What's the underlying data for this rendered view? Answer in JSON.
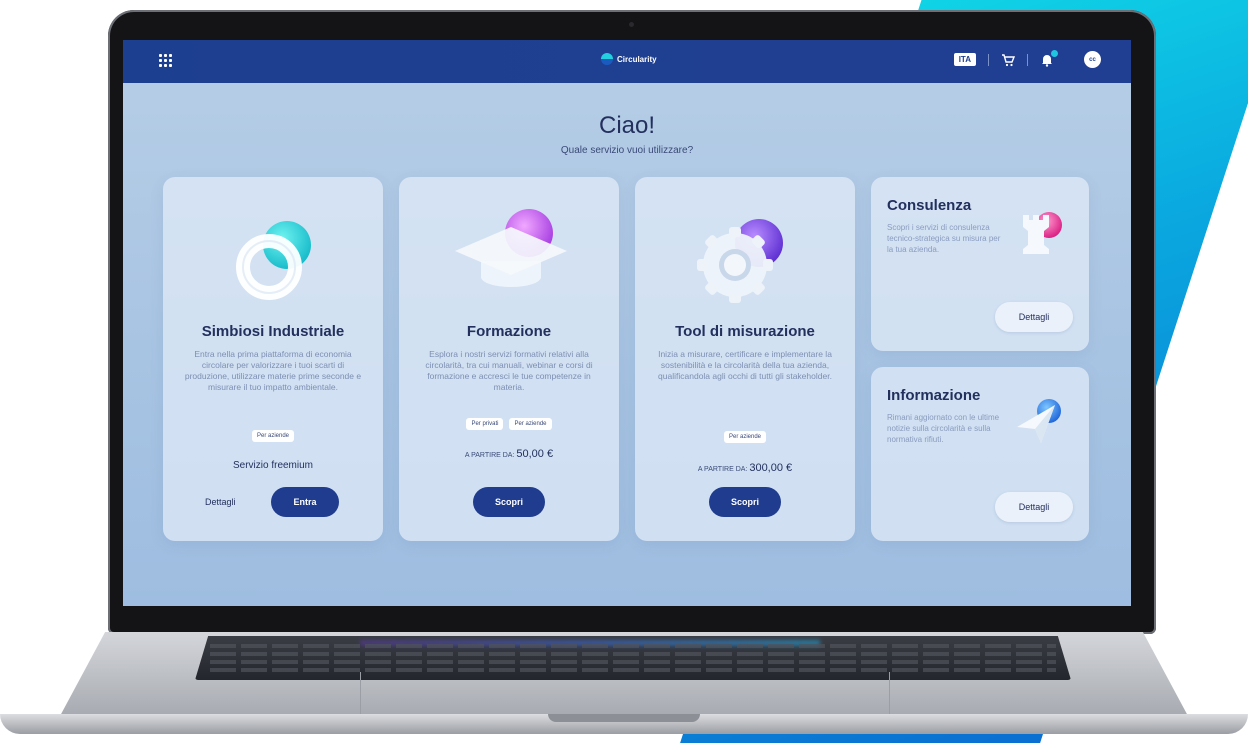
{
  "topbar": {
    "brand": "Circularity",
    "lang": "ITA",
    "avatar_initials": "cc"
  },
  "hero": {
    "title": "Ciao!",
    "subtitle": "Quale servizio vuoi utilizzare?"
  },
  "cards": [
    {
      "title": "Simbiosi Industriale",
      "description": "Entra nella prima piattaforma di economia circolare per valorizzare i tuoi scarti di produzione, utilizzare materie prime seconde e misurare il tuo impatto ambientale.",
      "chips": [
        "Per aziende"
      ],
      "note": "Servizio freemium",
      "link": "Dettagli",
      "button": "Entra"
    },
    {
      "title": "Formazione",
      "description": "Esplora i nostri servizi formativi relativi alla circolarità, tra cui manuali, webinar e corsi di formazione e accresci le tue competenze in materia.",
      "chips": [
        "Per privati",
        "Per aziende"
      ],
      "price_prefix": "A PARTIRE DA:",
      "price": "50,00 €",
      "button": "Scopri"
    },
    {
      "title": "Tool di misurazione",
      "description": "Inizia a misurare, certificare e implementare la sostenibilità e la circolarità della tua azienda, qualificandola agli occhi di tutti gli stakeholder.",
      "chips": [
        "Per aziende"
      ],
      "price_prefix": "A PARTIRE DA:",
      "price": "300,00 €",
      "button": "Scopri"
    }
  ],
  "side_cards": [
    {
      "title": "Consulenza",
      "description": "Scopri i servizi di consulenza tecnico-strategica su misura per la tua azienda.",
      "button": "Dettagli"
    },
    {
      "title": "Informazione",
      "description": "Rimani aggiornato con le ultime notizie sulla circolarità e sulla normativa rifiuti.",
      "button": "Dettagli"
    }
  ],
  "colors": {
    "primary": "#1f3c8e",
    "accent_cyan": "#1fc6e0",
    "accent_purple": "#8a4de0",
    "accent_pink": "#e0339a"
  },
  "icons": [
    "apps-grid-icon",
    "cart-icon",
    "bell-icon",
    "ring-icon",
    "graduation-cap-icon",
    "gear-icon",
    "chess-rook-icon",
    "paper-plane-icon"
  ]
}
